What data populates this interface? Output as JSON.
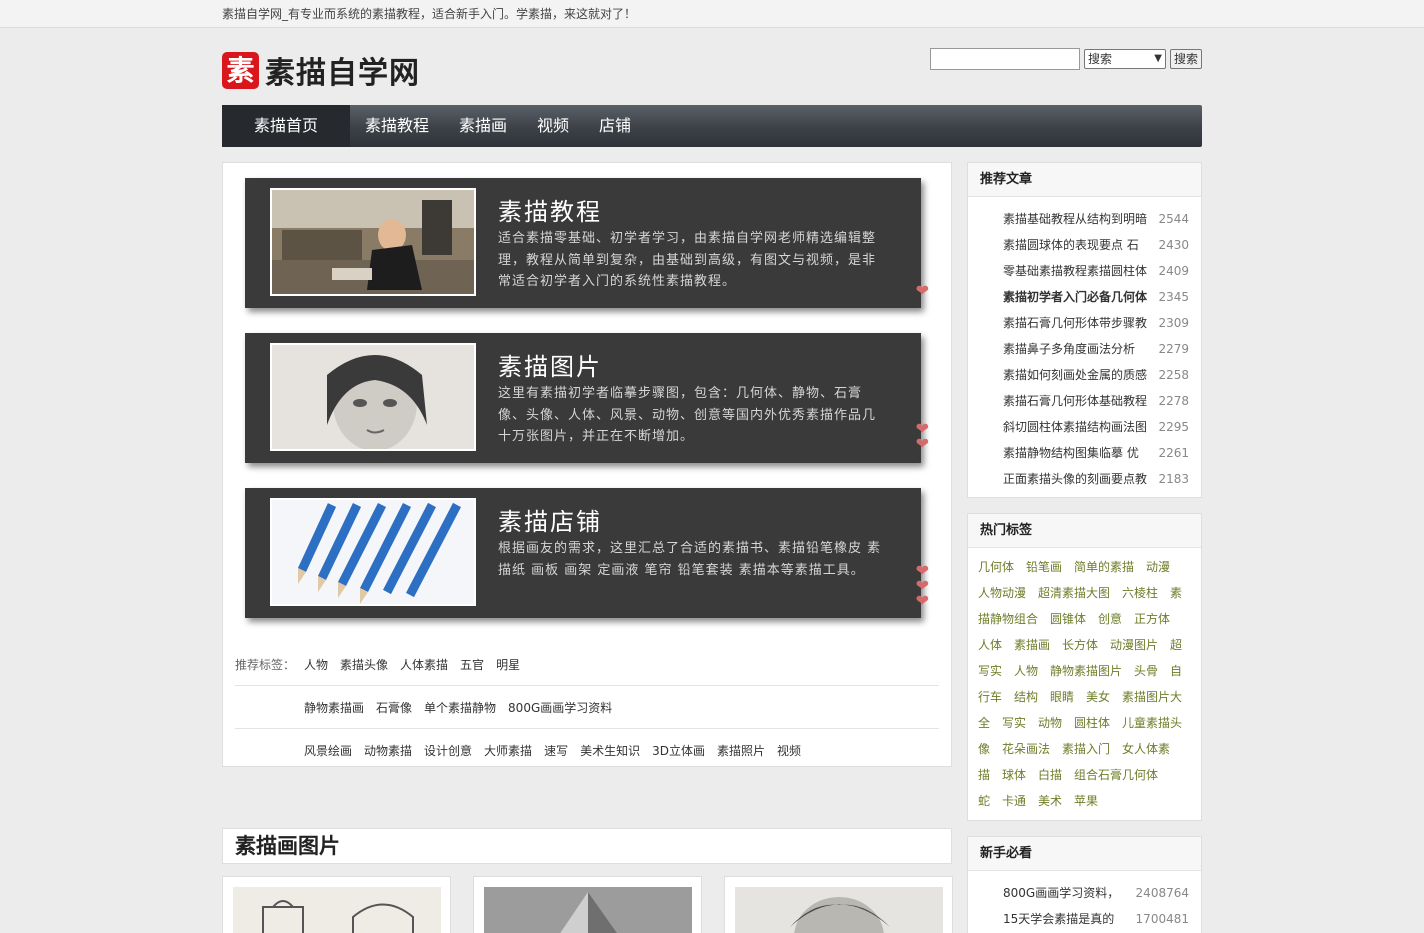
{
  "topbar": {
    "text": "素描自学网_有专业而系统的素描教程，适合新手入门。学素描，来这就对了！"
  },
  "logo": {
    "mark": "素",
    "text": "素描自学网"
  },
  "search": {
    "select_value": "搜索",
    "button_label": "搜索",
    "placeholder": ""
  },
  "nav": {
    "items": [
      "素描首页",
      "素描教程",
      "素描画",
      "视频",
      "店铺"
    ]
  },
  "features": [
    {
      "title": "素描教程",
      "desc": "适合素描零基础、初学者学习，由素描自学网老师精选编辑整理，教程从简单到复杂，由基础到高级，有图文与视频，是非常适合初学者入门的系统性素描教程。"
    },
    {
      "title": "素描图片",
      "desc": "这里有素描初学者临摹步骤图，包含：几何体、静物、石膏像、头像、人体、风景、动物、创意等国内外优秀素描作品几十万张图片，并正在不断增加。"
    },
    {
      "title": "素描店铺",
      "desc": "根据画友的需求，这里汇总了合适的素描书、素描铅笔橡皮 素描纸 画板 画架 定画液 笔帘 铅笔套装 素描本等素描工具。"
    }
  ],
  "recommend_tags": {
    "label": "推荐标签：",
    "rows": [
      [
        "人物",
        "素描头像",
        "人体素描",
        "五官",
        "明星"
      ],
      [
        "静物素描画",
        "石膏像",
        "单个素描静物",
        "800G画画学习资料"
      ],
      [
        "风景绘画",
        "动物素描",
        "设计创意",
        "大师素描",
        "速写",
        "美术生知识",
        "3D立体画",
        "素描照片",
        "视频"
      ]
    ]
  },
  "gallery": {
    "title": "素描画图片"
  },
  "sidebar": {
    "recommended": {
      "title": "推荐文章",
      "items": [
        {
          "title": "素描基础教程从结构到明暗",
          "count": "2544"
        },
        {
          "title": "素描圆球体的表现要点 石",
          "count": "2430"
        },
        {
          "title": "零基础素描教程素描圆柱体",
          "count": "2409"
        },
        {
          "title": "素描初学者入门必备几何体",
          "count": "2345"
        },
        {
          "title": "素描石膏几何形体带步骤教",
          "count": "2309"
        },
        {
          "title": "素描鼻子多角度画法分析",
          "count": "2279"
        },
        {
          "title": "素描如何刻画处金属的质感",
          "count": "2258"
        },
        {
          "title": "素描石膏几何形体基础教程",
          "count": "2278"
        },
        {
          "title": "斜切圆柱体素描结构画法图",
          "count": "2295"
        },
        {
          "title": "素描静物结构图集临摹 优",
          "count": "2261"
        },
        {
          "title": "正面素描头像的刻画要点教",
          "count": "2183"
        }
      ]
    },
    "hot_tags": {
      "title": "热门标签",
      "lines": [
        "几何体　铅笔画　简单的素描　动漫",
        "人物动漫　超清素描大图　六棱柱　素",
        "描静物组合　圆锥体　创意　正方体",
        "人体　素描画　长方体　动漫图片　超",
        "写实　人物　静物素描图片　头骨　自",
        "行车　结构　眼睛　美女　素描图片大",
        "全　写实　动物　圆柱体　儿童素描头",
        "像　花朵画法　素描入门　女人体素",
        "描　球体　白描　组合石膏几何体",
        "蛇　卡通　美术　苹果"
      ]
    },
    "newbie": {
      "title": "新手必看",
      "items": [
        {
          "title": "800G画画学习资料，",
          "count": "2408764"
        },
        {
          "title": "15天学会素描是真的",
          "count": "1700481"
        }
      ]
    }
  }
}
